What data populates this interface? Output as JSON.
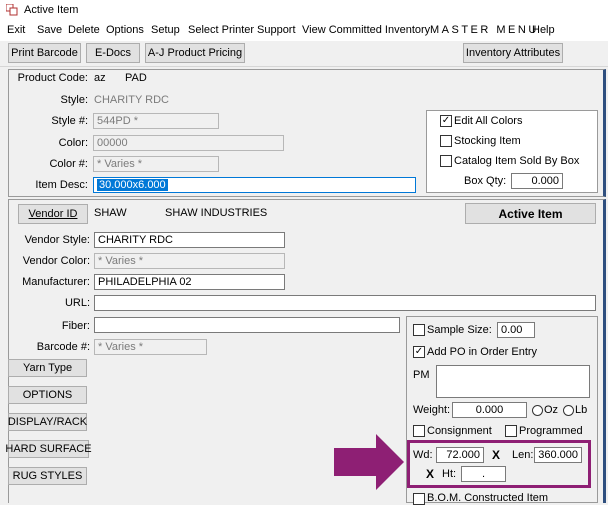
{
  "window": {
    "title": "Active Item"
  },
  "menu": [
    "Exit",
    "Save",
    "Delete",
    "Options",
    "Setup",
    "Select Printer",
    "Support",
    "View Committed Inventory",
    "MASTER MENU",
    "Help"
  ],
  "toolbar": {
    "print_barcode": "Print Barcode",
    "edocs": "E-Docs",
    "aj_pricing": "A-J Product Pricing",
    "inventory_attributes": "Inventory Attributes"
  },
  "product": {
    "code_label": "Product Code:",
    "code_prefix": "az",
    "code_value": "PAD",
    "style_label": "Style:",
    "style_value": "CHARITY RDC",
    "style_num_label": "Style #:",
    "style_num_value": "544PD *",
    "color_label": "Color:",
    "color_value": "00000",
    "color_num_label": "Color #:",
    "color_num_value": "* Varies *",
    "item_desc_label": "Item Desc:",
    "item_desc_value": "30.000x6.000"
  },
  "options_box": {
    "edit_all_colors": "Edit All Colors",
    "edit_all_colors_checked": true,
    "stocking_item": "Stocking Item",
    "stocking_item_checked": false,
    "catalog_item": "Catalog Item Sold By Box",
    "catalog_item_checked": false,
    "box_qty_label": "Box Qty:",
    "box_qty_value": "0.000"
  },
  "vendor": {
    "vendor_id_button": "Vendor ID",
    "vendor_code": "SHAW",
    "vendor_name": "SHAW INDUSTRIES",
    "active_item_button": "Active Item",
    "vendor_style_label": "Vendor Style:",
    "vendor_style_value": "CHARITY RDC",
    "vendor_color_label": "Vendor Color:",
    "vendor_color_value": "* Varies *",
    "manufacturer_label": "Manufacturer:",
    "manufacturer_value": "PHILADELPHIA 02",
    "url_label": "URL:",
    "url_value": "",
    "fiber_label": "Fiber:",
    "fiber_value": "",
    "barcode_label": "Barcode #:",
    "barcode_value": "* Varies *"
  },
  "side_buttons": {
    "yarn_type": "Yarn Type",
    "options": "OPTIONS",
    "display_rack": "DISPLAY/RACK",
    "hard_surface": "HARD SURFACE",
    "rug_styles": "RUG STYLES"
  },
  "attributes": {
    "sample_size_label": "Sample Size:",
    "sample_size_value": "0.00",
    "sample_size_checked": false,
    "add_po_label": "Add PO in Order Entry",
    "add_po_checked": true,
    "pm_label": "PM",
    "pm_value": "",
    "weight_label": "Weight:",
    "weight_value": "0.000",
    "oz_label": "Oz",
    "lb_label": "Lb",
    "consignment_label": "Consignment",
    "consignment_checked": false,
    "programmed_label": "Programmed",
    "programmed_checked": false,
    "wd_label": "Wd:",
    "wd_value": "72.000",
    "x_label": "X",
    "len_label": "Len:",
    "len_value": "360.000",
    "ht_label": "Ht:",
    "ht_value": ".",
    "bom_label": "B.O.M. Constructed Item",
    "bom_checked": false
  },
  "colors": {
    "highlight": "#8e1f74",
    "selection": "#0078d7"
  }
}
